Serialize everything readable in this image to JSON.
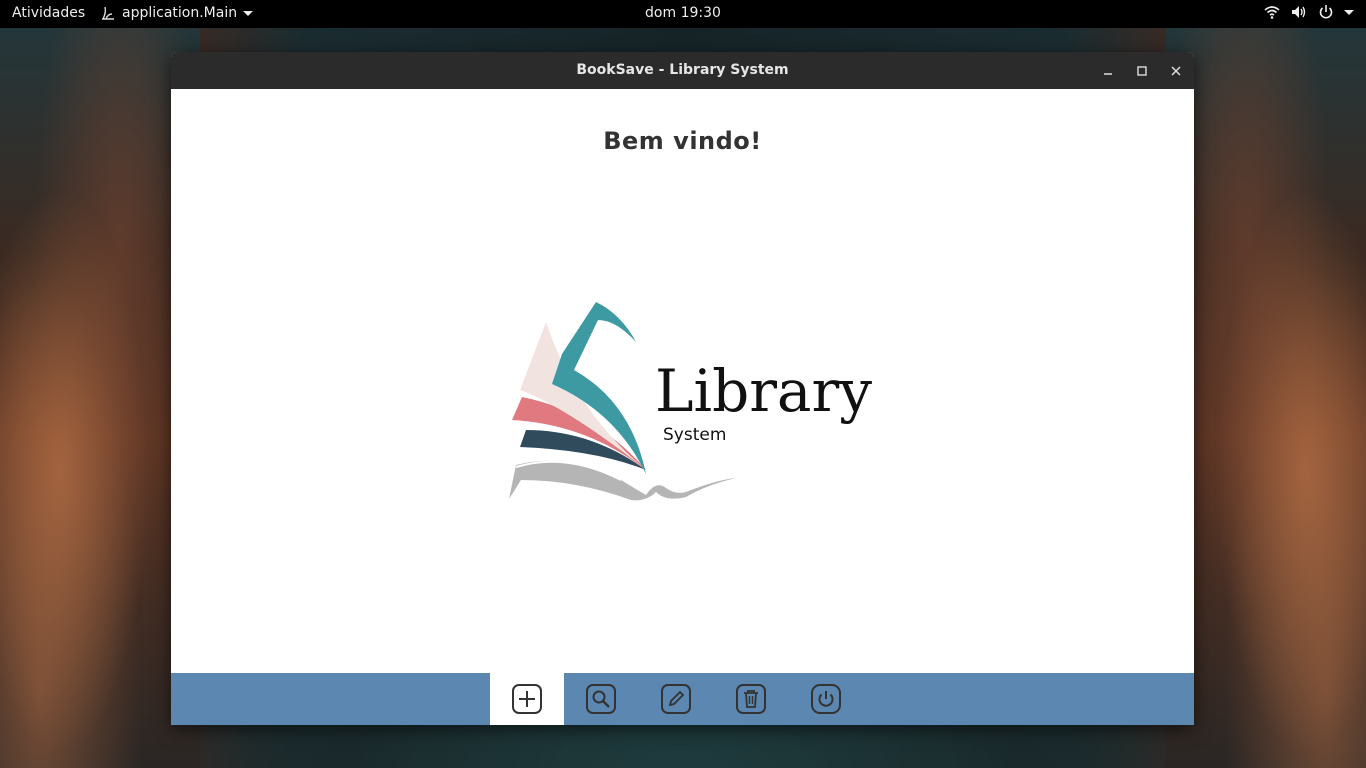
{
  "topbar": {
    "activities": "Atividades",
    "app_menu": "application.Main",
    "clock": "dom 19:30"
  },
  "window": {
    "title": "BookSave - Library System"
  },
  "main": {
    "welcome": "Bem vindo!",
    "logo_word": "Library",
    "logo_sub": "System"
  },
  "toolbar": {
    "active": "add",
    "buttons": [
      "add",
      "search",
      "edit",
      "delete",
      "power"
    ]
  },
  "colors": {
    "toolbar_bg": "#5b87b1",
    "logo_teal": "#3d9aa3",
    "logo_pink": "#e07a80",
    "logo_navy": "#2f4b5c",
    "logo_cream": "#f1e4e0",
    "logo_gray": "#b5b5b5"
  }
}
